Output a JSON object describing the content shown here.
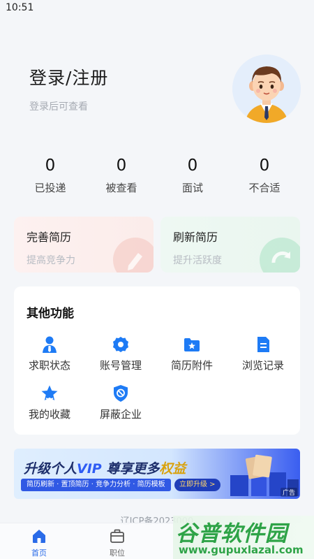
{
  "status_bar": {
    "time": "10:51"
  },
  "profile": {
    "title": "登录/注册",
    "subtitle": "登录后可查看"
  },
  "stats": [
    {
      "value": "0",
      "label": "已投递"
    },
    {
      "value": "0",
      "label": "被查看"
    },
    {
      "value": "0",
      "label": "面试"
    },
    {
      "value": "0",
      "label": "不合适"
    }
  ],
  "resume_cards": [
    {
      "title": "完善简历",
      "subtitle": "提高竞争力"
    },
    {
      "title": "刷新简历",
      "subtitle": "提升活跃度"
    }
  ],
  "features": {
    "title": "其他功能",
    "items": [
      {
        "label": "求职状态",
        "icon": "job-status-icon"
      },
      {
        "label": "账号管理",
        "icon": "gear-icon"
      },
      {
        "label": "简历附件",
        "icon": "folder-star-icon"
      },
      {
        "label": "浏览记录",
        "icon": "document-icon"
      },
      {
        "label": "我的收藏",
        "icon": "star-icon"
      },
      {
        "label": "屏蔽企业",
        "icon": "block-shield-icon"
      }
    ]
  },
  "banner": {
    "title_part1": "升级个人",
    "title_vip": "VIP",
    "title_part2": "尊享更多",
    "title_gold": "权益",
    "features_text": "简历刷新 · 置顶简历 · 竞争力分析 · 简历模板",
    "button_label": "立即升级 >",
    "ad_tag": "广告"
  },
  "icp": "辽ICP备2023000",
  "tabbar": [
    {
      "label": "首页",
      "icon": "home-icon"
    },
    {
      "label": "职位",
      "icon": "briefcase-icon"
    }
  ],
  "watermark": {
    "brand": "谷普软件园",
    "url": "www.gupuxlazal.com"
  },
  "colors": {
    "accent": "#2a6be8",
    "icon_blue": "#1e7bf5",
    "background": "#f4f6f9"
  }
}
